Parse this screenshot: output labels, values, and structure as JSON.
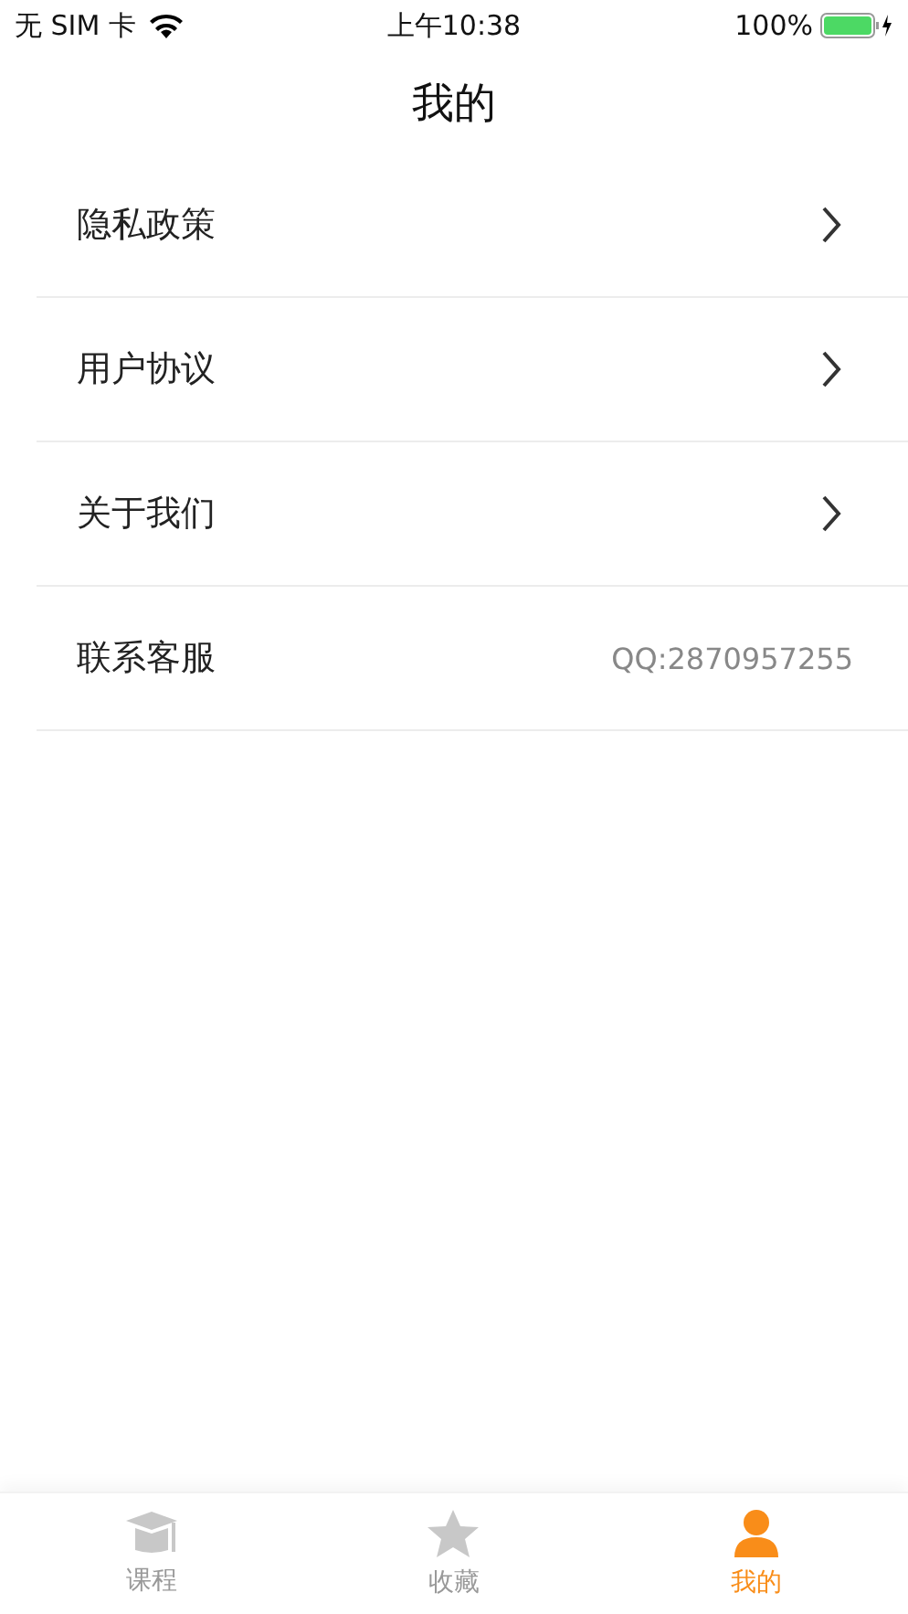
{
  "status_bar": {
    "carrier": "无 SIM 卡",
    "time": "上午10:38",
    "battery": "100%"
  },
  "nav": {
    "title": "我的"
  },
  "menu": [
    {
      "label": "隐私政策",
      "kind": "link"
    },
    {
      "label": "用户协议",
      "kind": "link"
    },
    {
      "label": "关于我们",
      "kind": "link"
    },
    {
      "label": "联系客服",
      "kind": "info",
      "value": "QQ:2870957255"
    }
  ],
  "tabs": [
    {
      "label": "课程",
      "kind": "cap",
      "selected": false
    },
    {
      "label": "收藏",
      "kind": "star",
      "selected": false
    },
    {
      "label": "我的",
      "kind": "person",
      "selected": true
    }
  ]
}
